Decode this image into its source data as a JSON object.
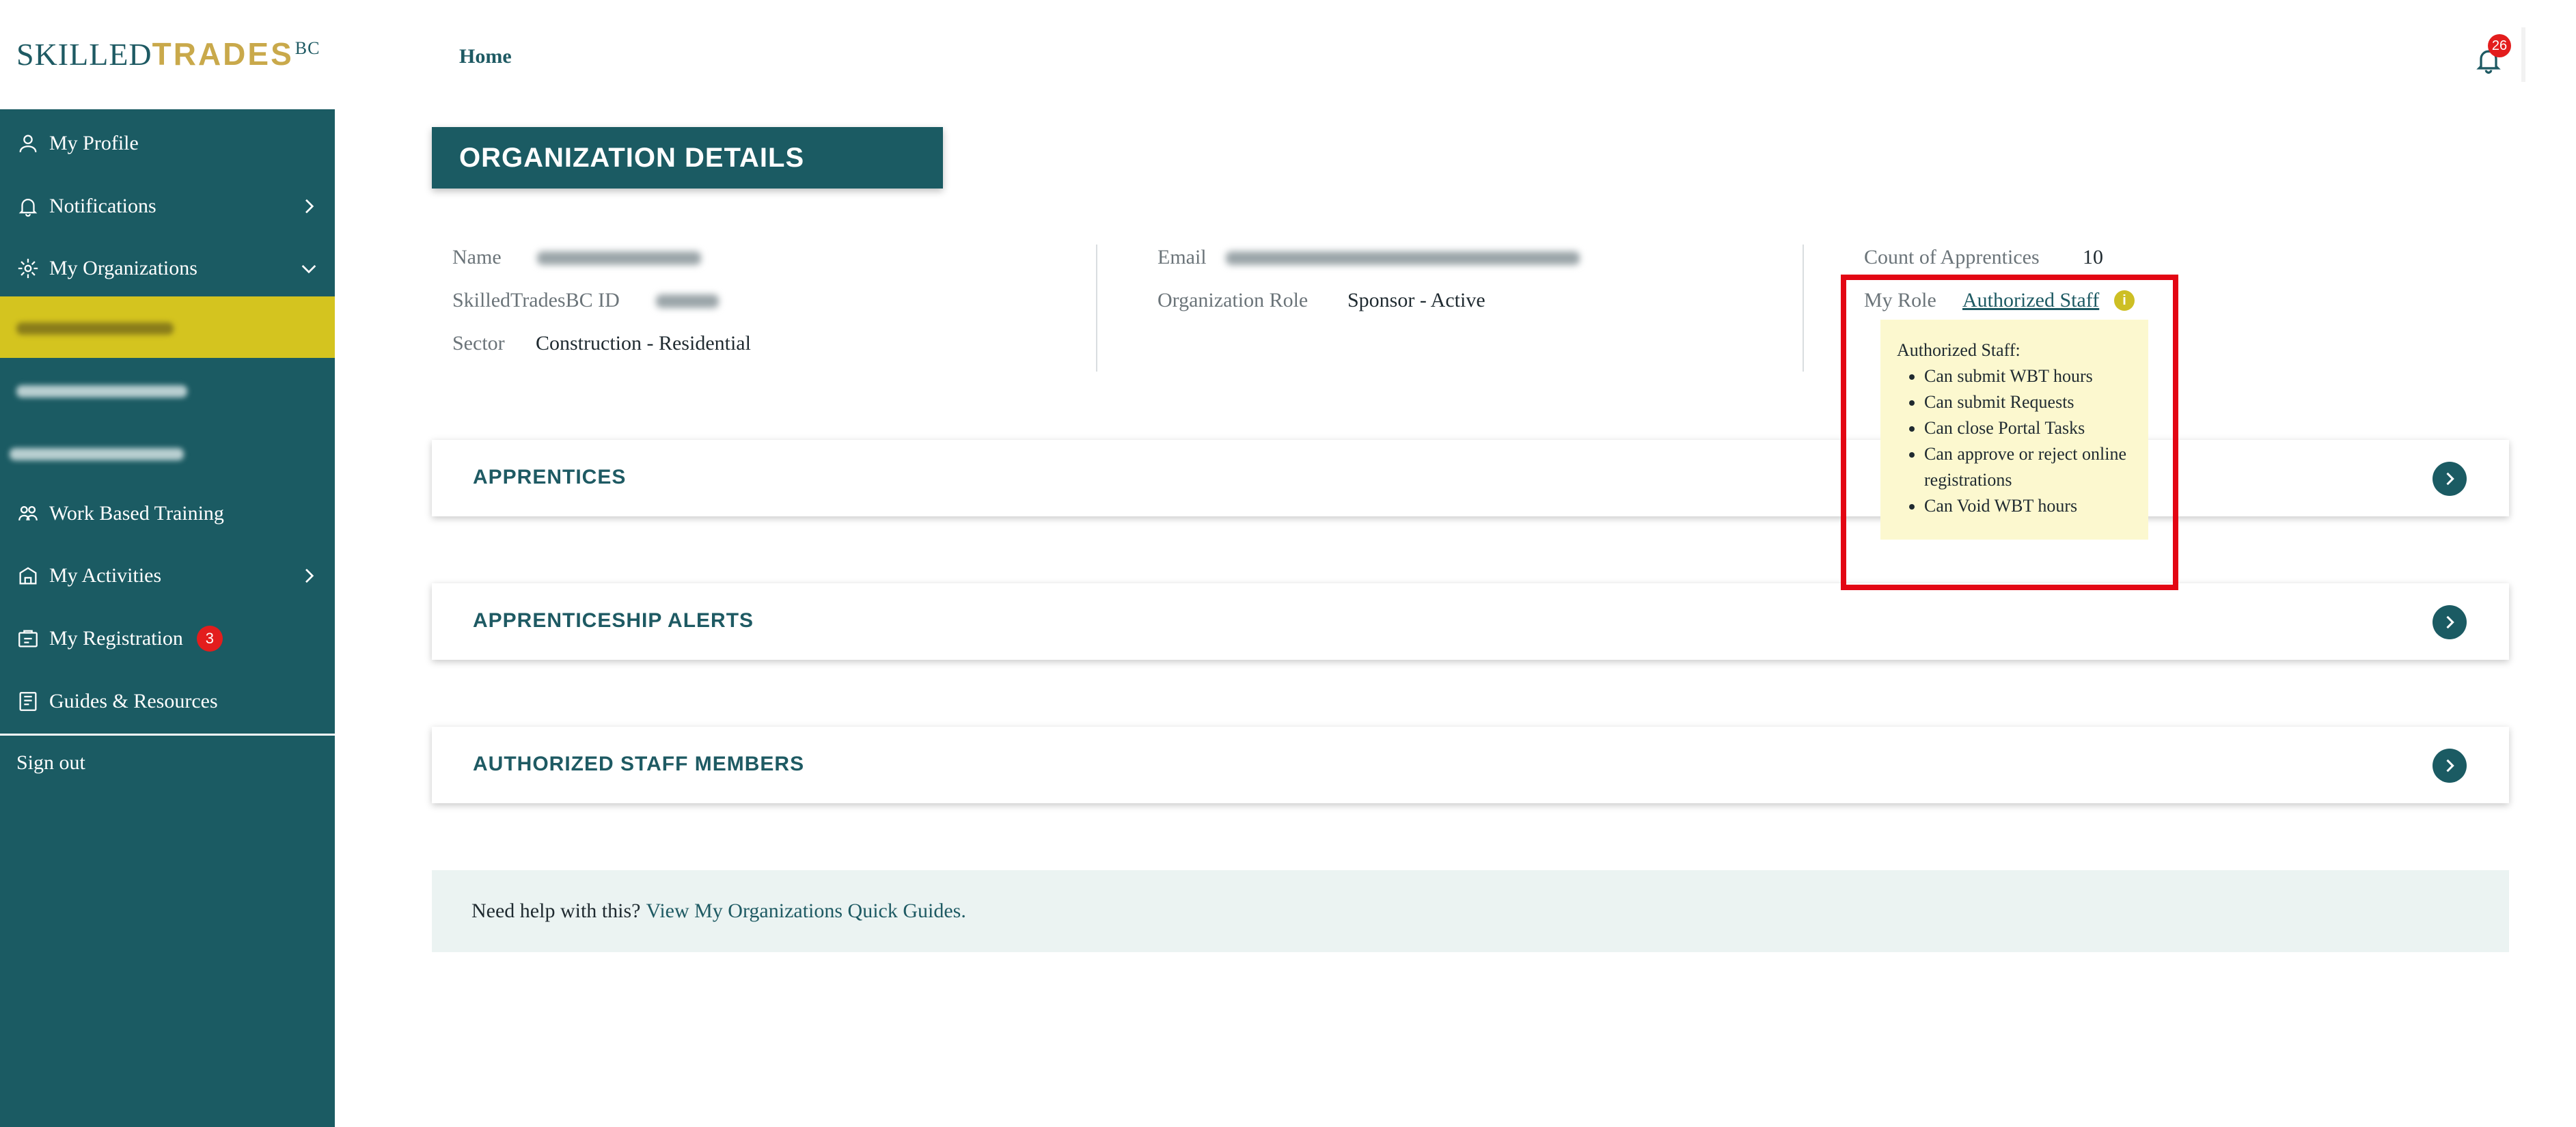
{
  "brand": {
    "logo_part1": "SKILLED",
    "logo_part2": "TRADES",
    "logo_part3": "BC"
  },
  "topbar": {
    "home_label": "Home",
    "notification_count": "26"
  },
  "sidebar": {
    "items": [
      {
        "label": "My Profile",
        "icon": "user-icon"
      },
      {
        "label": "Notifications",
        "icon": "bell-icon",
        "chevron": "right"
      },
      {
        "label": "My Organizations",
        "icon": "cog-icon",
        "chevron": "down"
      },
      {
        "label": "Work Based Training",
        "icon": "group-icon"
      },
      {
        "label": "My Activities",
        "icon": "activities-icon",
        "chevron": "right"
      },
      {
        "label": "My Registration",
        "icon": "registration-icon",
        "badge": "3"
      },
      {
        "label": "Guides & Resources",
        "icon": "guides-icon"
      }
    ],
    "signout_label": "Sign out",
    "colors": {
      "background": "#1b5b63",
      "active_org": "#d4c41f"
    }
  },
  "page": {
    "title": "ORGANIZATION DETAILS"
  },
  "details": {
    "name_label": "Name",
    "id_label": "SkilledTradesBC ID",
    "sector_label": "Sector",
    "sector_value": "Construction - Residential",
    "email_label": "Email",
    "role_label": "Organization Role",
    "role_value": "Sponsor - Active",
    "count_label": "Count of Apprentices",
    "count_value": "10",
    "my_role_label": "My Role",
    "my_role_value": "Authorized Staff"
  },
  "tooltip": {
    "title": "Authorized Staff:",
    "items": [
      "Can submit WBT hours",
      "Can submit Requests",
      "Can close Portal Tasks",
      "Can approve or reject online registrations",
      "Can Void WBT hours"
    ]
  },
  "cards": [
    {
      "title": "APPRENTICES"
    },
    {
      "title": "APPRENTICESHIP ALERTS"
    },
    {
      "title": "AUTHORIZED STAFF MEMBERS"
    }
  ],
  "help": {
    "text": "Need help with this?",
    "link": "View My Organizations Quick Guides."
  }
}
